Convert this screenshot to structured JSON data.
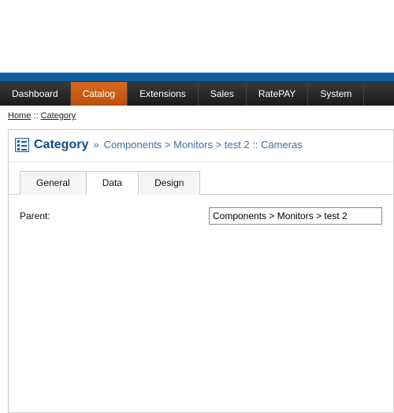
{
  "nav": {
    "items": [
      {
        "label": "Dashboard",
        "active": false
      },
      {
        "label": "Catalog",
        "active": true
      },
      {
        "label": "Extensions",
        "active": false
      },
      {
        "label": "Sales",
        "active": false
      },
      {
        "label": "RatePAY",
        "active": false
      },
      {
        "label": "System",
        "active": false
      }
    ]
  },
  "breadcrumb": {
    "home": "Home",
    "sep": " :: ",
    "current": "Category"
  },
  "heading": {
    "title": "Category",
    "raquo": "»",
    "path": "Components > Monitors > test 2 :: Cameras"
  },
  "tabs": {
    "items": [
      {
        "label": "General",
        "active": false
      },
      {
        "label": "Data",
        "active": true
      },
      {
        "label": "Design",
        "active": false
      }
    ]
  },
  "form": {
    "parent_label": "Parent:",
    "parent_value": "Components > Monitors > test 2"
  }
}
